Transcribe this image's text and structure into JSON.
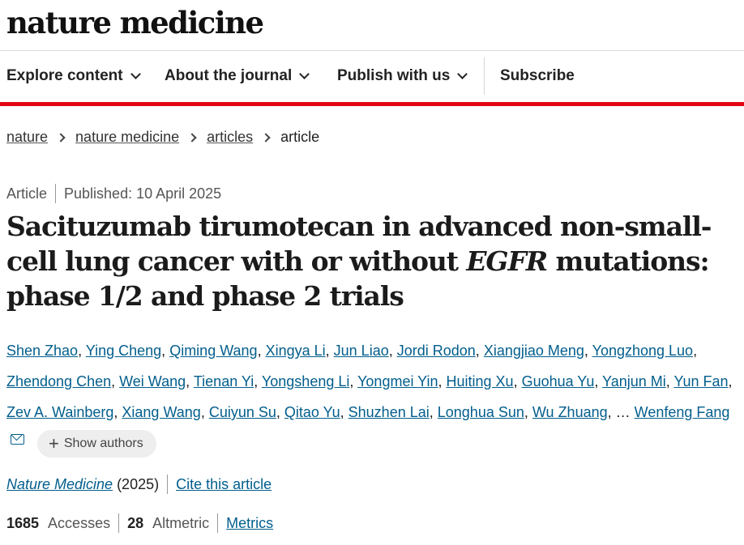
{
  "site": {
    "logo": "nature medicine"
  },
  "nav": {
    "items": [
      {
        "label": "Explore content"
      },
      {
        "label": "About the journal"
      },
      {
        "label": "Publish with us"
      }
    ],
    "subscribe": "Subscribe"
  },
  "colors": {
    "accent_bar": "#e30613",
    "link": "#025e8d"
  },
  "breadcrumb": [
    {
      "label": "nature"
    },
    {
      "label": "nature medicine"
    },
    {
      "label": "articles"
    },
    {
      "label": "article"
    }
  ],
  "article": {
    "type": "Article",
    "published": "Published: 10 April 2025",
    "title_part1": "Sacituzumab tirumotecan in advanced non-small-cell lung cancer with or without ",
    "title_italic": "EGFR",
    "title_part2": " mutations: phase 1/2 and phase 2 trials",
    "authors": [
      "Shen Zhao",
      "Ying Cheng",
      "Qiming Wang",
      "Xingya Li",
      "Jun Liao",
      "Jordi Rodon",
      "Xiangjiao Meng",
      "Yongzhong Luo",
      "Zhendong Chen",
      "Wei Wang",
      "Tienan Yi",
      "Yongsheng Li",
      "Yongmei Yin",
      "Huiting Xu",
      "Guohua Yu",
      "Yanjun Mi",
      "Yun Fan",
      "Zev A. Wainberg",
      "Xiang Wang",
      "Cuiyun Su",
      "Qitao Yu",
      "Shuzhen Lai",
      "Longhua Sun",
      "Wu Zhuang"
    ],
    "ellipsis": "…",
    "last_author": "Wenfeng Fang",
    "show_authors": "Show authors",
    "journal": "Nature Medicine",
    "year": "(2025)",
    "cite": "Cite this article"
  },
  "metrics": {
    "accesses_count": "1685",
    "accesses_label": "Accesses",
    "altmetric_count": "28",
    "altmetric_label": "Altmetric",
    "metrics_link": "Metrics"
  }
}
